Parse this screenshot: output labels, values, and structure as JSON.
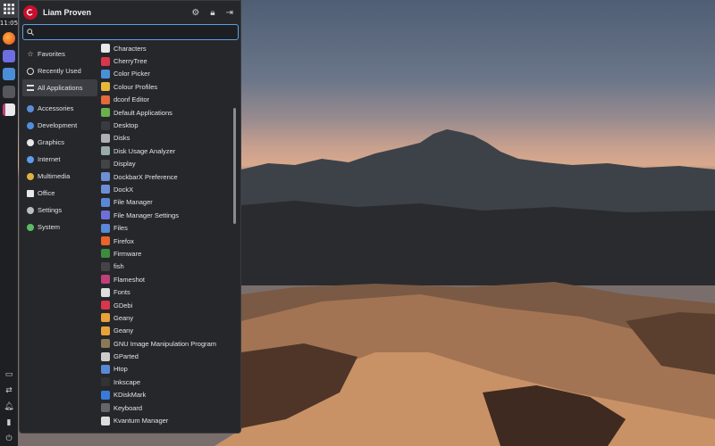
{
  "panel": {
    "clock": "11:05"
  },
  "menu": {
    "user_name": "Liam Proven",
    "search_placeholder": "",
    "categories": [
      {
        "label": "Favorites",
        "icon": "star-icon"
      },
      {
        "label": "Recently Used",
        "icon": "clock-icon"
      },
      {
        "label": "All Applications",
        "icon": "list-icon",
        "active": true
      },
      {
        "label": "Accessories",
        "icon": "accessories-icon",
        "color": "#5b8dd6"
      },
      {
        "label": "Development",
        "icon": "development-icon",
        "color": "#4f8fe0"
      },
      {
        "label": "Graphics",
        "icon": "graphics-icon",
        "color": "#e8e8e8"
      },
      {
        "label": "Internet",
        "icon": "internet-icon",
        "color": "#5b9ee8"
      },
      {
        "label": "Multimedia",
        "icon": "multimedia-icon",
        "color": "#e0b040"
      },
      {
        "label": "Office",
        "icon": "office-icon",
        "color": "#e8e8e8"
      },
      {
        "label": "Settings",
        "icon": "settings-icon",
        "color": "#bdbdbd"
      },
      {
        "label": "System",
        "icon": "system-icon",
        "color": "#5dbb63"
      }
    ],
    "apps": [
      {
        "label": "Characters",
        "color": "#e9e9e9"
      },
      {
        "label": "CherryTree",
        "color": "#d8364a"
      },
      {
        "label": "Color Picker",
        "color": "#4a90d9"
      },
      {
        "label": "Colour Profiles",
        "color": "#e9b73a"
      },
      {
        "label": "dconf Editor",
        "color": "#e26a3b"
      },
      {
        "label": "Default Applications",
        "color": "#6ab04c"
      },
      {
        "label": "Desktop",
        "color": "#3a3b3f"
      },
      {
        "label": "Disks",
        "color": "#b0b0b0"
      },
      {
        "label": "Disk Usage Analyzer",
        "color": "#9aa"
      },
      {
        "label": "Display",
        "color": "#444"
      },
      {
        "label": "DockbarX Preference",
        "color": "#6c8fd6"
      },
      {
        "label": "DockX",
        "color": "#6c8fd6"
      },
      {
        "label": "File Manager",
        "color": "#5a88d8"
      },
      {
        "label": "File Manager Settings",
        "color": "#6f6fd8"
      },
      {
        "label": "Files",
        "color": "#5a88d8"
      },
      {
        "label": "Firefox",
        "color": "#e8642a"
      },
      {
        "label": "Firmware",
        "color": "#3d8b3d"
      },
      {
        "label": "fish",
        "color": "#444"
      },
      {
        "label": "Flameshot",
        "color": "#c0407a"
      },
      {
        "label": "Fonts",
        "color": "#ddd"
      },
      {
        "label": "GDebi",
        "color": "#d8364a"
      },
      {
        "label": "Geany",
        "color": "#e8a23a"
      },
      {
        "label": "Geany",
        "color": "#e8a23a"
      },
      {
        "label": "GNU Image Manipulation Program",
        "color": "#8a7a5a"
      },
      {
        "label": "GParted",
        "color": "#ccc"
      },
      {
        "label": "Htop",
        "color": "#5a88d8"
      },
      {
        "label": "Inkscape",
        "color": "#333"
      },
      {
        "label": "KDiskMark",
        "color": "#3a7ad8"
      },
      {
        "label": "Keyboard",
        "color": "#666"
      },
      {
        "label": "Kvantum Manager",
        "color": "#ddd"
      }
    ]
  }
}
